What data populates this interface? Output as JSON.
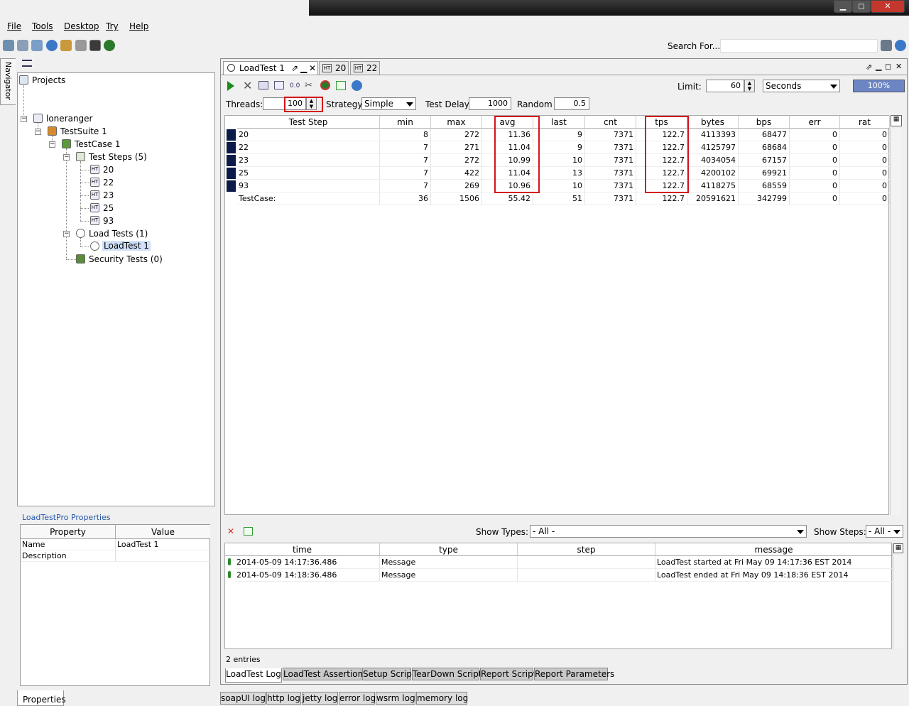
{
  "window": {
    "min_glyph": "▁",
    "max_glyph": "◻",
    "close_glyph": "✕"
  },
  "menu": [
    "File",
    "Tools",
    "Desktop",
    "Try",
    "Help"
  ],
  "toolbar": {
    "search_label": "Search For..."
  },
  "navigator": {
    "tab_label": "Navigator",
    "projects_label": "Projects",
    "tree": {
      "project": "loneranger",
      "suite": "TestSuite 1",
      "testcase": "TestCase 1",
      "steps_folder": "Test Steps (5)",
      "steps": [
        "20",
        "22",
        "23",
        "25",
        "93"
      ],
      "load_folder": "Load Tests (1)",
      "load_test": "LoadTest 1",
      "security_folder": "Security Tests (0)"
    }
  },
  "properties": {
    "title": "LoadTestPro Properties",
    "columns": [
      "Property",
      "Value"
    ],
    "rows": [
      [
        "Name",
        "LoadTest 1"
      ],
      [
        "Description",
        ""
      ]
    ],
    "tab_label": "Properties"
  },
  "doc_tabs": [
    {
      "label": "LoadTest 1"
    },
    {
      "label": "20"
    },
    {
      "label": "22"
    }
  ],
  "controls": {
    "limit_label": "Limit:",
    "limit_value": "60",
    "limit_unit": "Seconds",
    "progress": "100%",
    "threads_label": "Threads:",
    "threads_value": "100",
    "strategy_label": "Strategy",
    "strategy_value": "Simple",
    "delay_label": "Test Delay",
    "delay_value": "1000",
    "random_label": "Random",
    "random_value": "0.5"
  },
  "stats": {
    "columns": [
      "Test Step",
      "min",
      "max",
      "avg",
      "last",
      "cnt",
      "tps",
      "bytes",
      "bps",
      "err",
      "rat"
    ],
    "rows": [
      [
        "20",
        "8",
        "272",
        "11.36",
        "9",
        "7371",
        "122.7",
        "4113393",
        "68477",
        "0",
        "0"
      ],
      [
        "22",
        "7",
        "271",
        "11.04",
        "9",
        "7371",
        "122.7",
        "4125797",
        "68684",
        "0",
        "0"
      ],
      [
        "23",
        "7",
        "272",
        "10.99",
        "10",
        "7371",
        "122.7",
        "4034054",
        "67157",
        "0",
        "0"
      ],
      [
        "25",
        "7",
        "422",
        "11.04",
        "13",
        "7371",
        "122.7",
        "4200102",
        "69921",
        "0",
        "0"
      ],
      [
        "93",
        "7",
        "269",
        "10.96",
        "10",
        "7371",
        "122.7",
        "4118275",
        "68559",
        "0",
        "0"
      ],
      [
        "TestCase:",
        "36",
        "1506",
        "55.42",
        "51",
        "7371",
        "122.7",
        "20591621",
        "342799",
        "0",
        "0"
      ]
    ]
  },
  "log": {
    "show_types_label": "Show Types:",
    "show_types_value": "- All -",
    "show_steps_label": "Show Steps:",
    "show_steps_value": "- All -",
    "columns": [
      "time",
      "type",
      "step",
      "message"
    ],
    "rows": [
      [
        "2014-05-09 14:17:36.486",
        "Message",
        "",
        "LoadTest started at Fri May 09 14:17:36 EST 2014"
      ],
      [
        "2014-05-09 14:18:36.486",
        "Message",
        "",
        "LoadTest ended at Fri May 09 14:18:36 EST 2014"
      ]
    ],
    "entries": "2 entries"
  },
  "bottom_tabs": [
    "LoadTest Log",
    "LoadTest Assertions",
    "Setup Script",
    "TearDown Script",
    "Report Script",
    "Report Parameters"
  ],
  "log_tabs": [
    "soapUI log",
    "http log",
    "jetty log",
    "error log",
    "wsrm log",
    "memory log"
  ]
}
